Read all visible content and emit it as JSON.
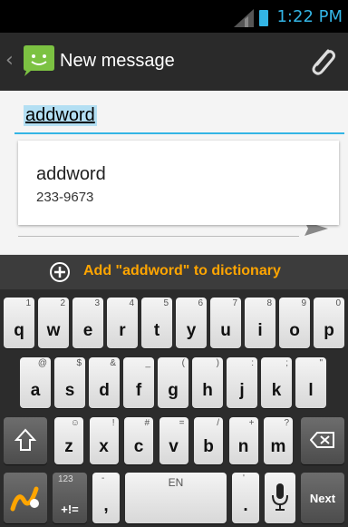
{
  "status_bar": {
    "time": "1:22 PM"
  },
  "action_bar": {
    "title": "New message"
  },
  "compose": {
    "to_value": "addword",
    "suggestion": {
      "name": "addword",
      "number": "233-9673"
    }
  },
  "keyboard": {
    "add_to_dictionary": "Add \"addword\" to dictionary",
    "row1": [
      {
        "main": "q",
        "hint": "1"
      },
      {
        "main": "w",
        "hint": "2"
      },
      {
        "main": "e",
        "hint": "3"
      },
      {
        "main": "r",
        "hint": "4"
      },
      {
        "main": "t",
        "hint": "5"
      },
      {
        "main": "y",
        "hint": "6"
      },
      {
        "main": "u",
        "hint": "7"
      },
      {
        "main": "i",
        "hint": "8"
      },
      {
        "main": "o",
        "hint": "9"
      },
      {
        "main": "p",
        "hint": "0"
      }
    ],
    "row2": [
      {
        "main": "a",
        "hint": "@"
      },
      {
        "main": "s",
        "hint": "$"
      },
      {
        "main": "d",
        "hint": "&"
      },
      {
        "main": "f",
        "hint": "_"
      },
      {
        "main": "g",
        "hint": "("
      },
      {
        "main": "h",
        "hint": ")"
      },
      {
        "main": "j",
        "hint": ":"
      },
      {
        "main": "k",
        "hint": ";"
      },
      {
        "main": "l",
        "hint": "\""
      }
    ],
    "row3": [
      {
        "main": "z",
        "hint": "☺"
      },
      {
        "main": "x",
        "hint": "!"
      },
      {
        "main": "c",
        "hint": "#"
      },
      {
        "main": "v",
        "hint": "="
      },
      {
        "main": "b",
        "hint": "/"
      },
      {
        "main": "n",
        "hint": "+"
      },
      {
        "main": "m",
        "hint": "?"
      }
    ],
    "symbols_key": {
      "top": "123",
      "bottom": "+!="
    },
    "comma_key": {
      "main": ",",
      "hint": "-"
    },
    "space_key": {
      "label": "EN"
    },
    "period_key": {
      "main": ".",
      "hint": "'"
    },
    "next_key": {
      "label": "Next"
    }
  }
}
